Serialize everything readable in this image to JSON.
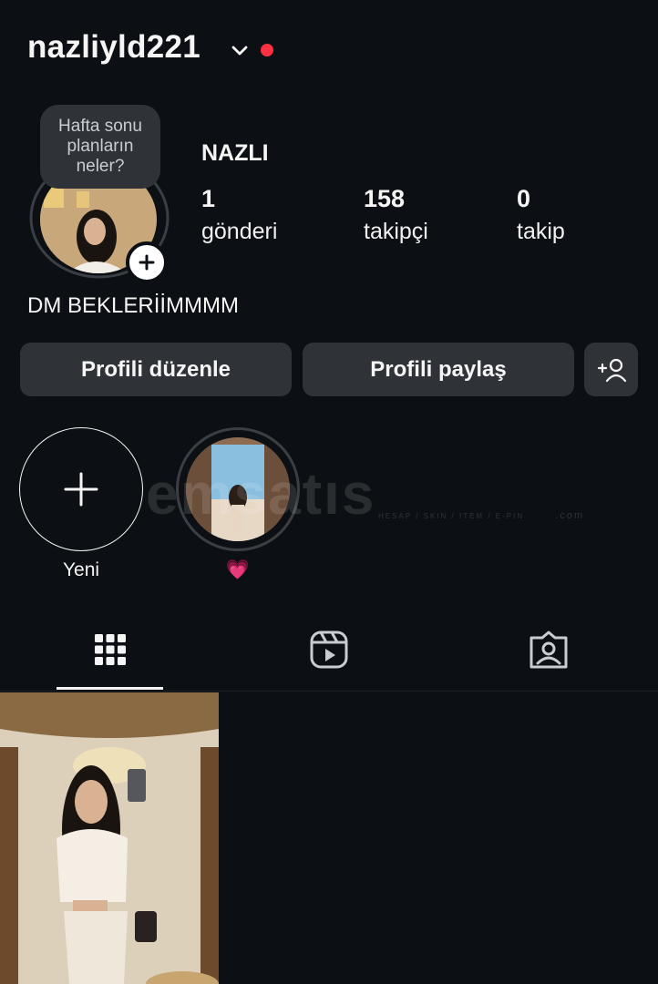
{
  "header": {
    "username": "nazliyld221",
    "chevron_icon": "chevron-down-icon",
    "notification_dot_color": "#ff3040"
  },
  "profile": {
    "note": "Hafta sonu planların neler?",
    "display_name": "NAZLI",
    "bio": "DM BEKLERİİMMMM",
    "stats": [
      {
        "value": "1",
        "label": "gönderi"
      },
      {
        "value": "158",
        "label": "takipçi"
      },
      {
        "value": "0",
        "label": "takip"
      }
    ]
  },
  "buttons": {
    "edit_profile": "Profili düzenle",
    "share_profile": "Profili paylaş",
    "discover_people_icon": "add-person-icon"
  },
  "highlights": [
    {
      "label": "Yeni",
      "icon": "plus-icon"
    },
    {
      "label": "💗",
      "icon": "highlight-cover"
    }
  ],
  "watermark": {
    "brand": "emsatıs",
    "sub": "HESAP / SKIN / ITEM / E-PIN",
    "suffix": ".com"
  },
  "tabs": [
    {
      "name": "grid",
      "icon": "grid-icon",
      "active": true
    },
    {
      "name": "reels",
      "icon": "reels-icon",
      "active": false
    },
    {
      "name": "tagged",
      "icon": "tagged-icon",
      "active": false
    }
  ],
  "colors": {
    "background": "#0c1014",
    "button_bg": "#2f3338",
    "text": "#f5f5f5"
  }
}
